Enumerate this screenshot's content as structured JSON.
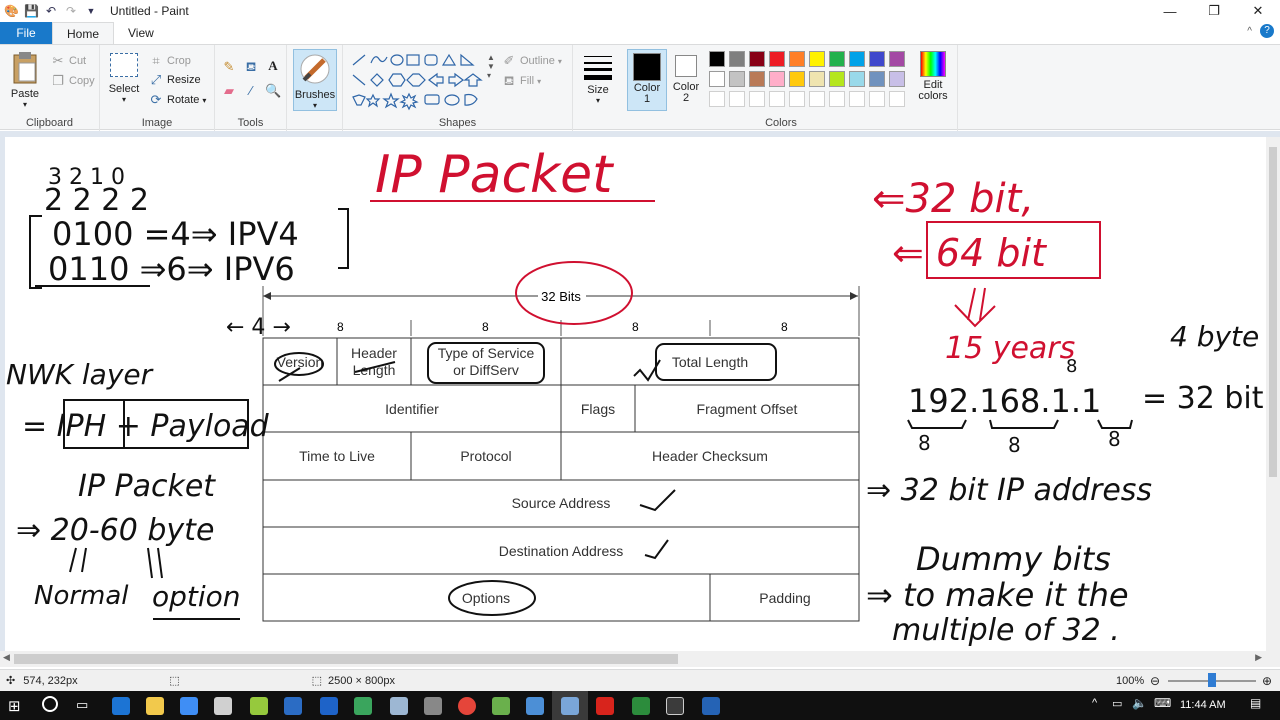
{
  "window": {
    "title": "Untitled - Paint",
    "minimize": "—",
    "maximize": "❐",
    "close": "✕"
  },
  "tabs": [
    {
      "label": "File"
    },
    {
      "label": "Home"
    },
    {
      "label": "View"
    }
  ],
  "ribbon": {
    "clipboard": {
      "paste": "Paste",
      "cut": "Cut",
      "copy": "Copy",
      "label": "Clipboard"
    },
    "image": {
      "select": "Select",
      "crop": "Crop",
      "resize": "Resize",
      "rotate": "Rotate",
      "label": "Image"
    },
    "tools": {
      "label": "Tools"
    },
    "brushes": {
      "label": "Brushes"
    },
    "shapes": {
      "outline": "Outline",
      "fill": "Fill",
      "label": "Shapes"
    },
    "size": {
      "label": "Size"
    },
    "color1": {
      "label": "Color\n1",
      "value": "#000000"
    },
    "color2": {
      "label": "Color\n2",
      "value": "#ffffff"
    },
    "colors": {
      "label": "Colors",
      "edit": "Edit colors",
      "row1": [
        "#000000",
        "#7f7f7f",
        "#880015",
        "#ed1c24",
        "#ff7f27",
        "#fff200",
        "#22b14c",
        "#00a2e8",
        "#3f48cc",
        "#a349a4"
      ],
      "row2": [
        "#ffffff",
        "#c3c3c3",
        "#b97a57",
        "#ffaec9",
        "#ffc90e",
        "#efe4b0",
        "#b5e61d",
        "#99d9ea",
        "#7092be",
        "#c8bfe7"
      ]
    }
  },
  "diagram": {
    "bits_label": "32 Bits",
    "tick_labels": [
      "8",
      "8",
      "8",
      "8"
    ],
    "rows": [
      [
        "Version",
        "Header\nLength",
        "Type of Service\nor DiffServ",
        "Total Length"
      ],
      [
        "Identifier",
        "Flags",
        "Fragment Offset"
      ],
      [
        "Time to Live",
        "Protocol",
        "Header Checksum"
      ],
      [
        "Source Address"
      ],
      [
        "Destination Address"
      ],
      [
        "Options",
        "Padding"
      ]
    ]
  },
  "handwriting": {
    "title": "IP Packet",
    "powers": "3 2 1 0",
    "base": "2 2 2 2",
    "ipv4": "0100 =4⇒ IPV4",
    "ipv6": "0110 ⇒6⇒ IPV6",
    "arrow4": "← 4 →",
    "nwk": "NWK layer",
    "iph": "= IPH + Payload",
    "ippacket": "IP Packet",
    "range": "⇒ 20-60 byte",
    "normal": "Normal",
    "option": "option",
    "bit32": "⇐32 bit,",
    "bit64": "⇐ 64 bit",
    "years": "15 years",
    "byte4": "4 byte",
    "ip": "192.168.1.1",
    "eq32": "= 32 bit",
    "eights": [
      "8",
      "8",
      "8"
    ],
    "top8": "8",
    "addr": "⇒ 32 bit IP address",
    "dummy": "Dummy bits",
    "make": "⇒ to make it the",
    "multiple": "multiple of 32 ."
  },
  "status": {
    "cursor": "574, 232px",
    "dimensions": "2500 × 800px",
    "zoom": "100%",
    "time": "11:44 AM"
  }
}
